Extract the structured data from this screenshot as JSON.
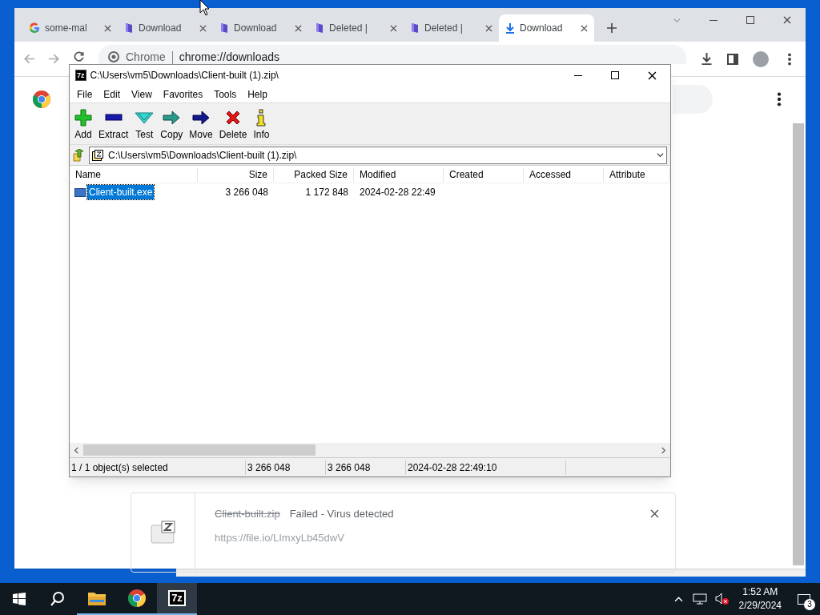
{
  "browser": {
    "tabs": [
      {
        "label": "some-mal",
        "kind": "google",
        "selected": false
      },
      {
        "label": "Download",
        "kind": "doc",
        "selected": false
      },
      {
        "label": "Download",
        "kind": "doc",
        "selected": false
      },
      {
        "label": "Deleted |",
        "kind": "doc",
        "selected": false
      },
      {
        "label": "Deleted |",
        "kind": "doc",
        "selected": false
      },
      {
        "label": "Download",
        "kind": "download",
        "selected": true
      }
    ],
    "address": {
      "site": "Chrome",
      "url": "chrome://downloads"
    },
    "download_card": {
      "file": "Client-built.zip",
      "status": "Failed - Virus detected",
      "url": "https://file.io/LImxyLb45dwV"
    }
  },
  "archiver": {
    "icon_label": "7z",
    "title": "C:\\Users\\vm5\\Downloads\\Client-built (1).zip\\",
    "menu": [
      "File",
      "Edit",
      "View",
      "Favorites",
      "Tools",
      "Help"
    ],
    "toolbar": [
      {
        "kind": "add",
        "label": "Add"
      },
      {
        "kind": "extract",
        "label": "Extract"
      },
      {
        "kind": "test",
        "label": "Test"
      },
      {
        "kind": "copy",
        "label": "Copy"
      },
      {
        "kind": "move",
        "label": "Move"
      },
      {
        "kind": "delete",
        "label": "Delete"
      },
      {
        "kind": "info",
        "label": "Info"
      }
    ],
    "path": "C:\\Users\\vm5\\Downloads\\Client-built (1).zip\\",
    "columns": [
      "Name",
      "Size",
      "Packed Size",
      "Modified",
      "Created",
      "Accessed",
      "Attribute"
    ],
    "rows": [
      {
        "name": "Client-built.exe",
        "size": "3 266 048",
        "packed": "1 172 848",
        "modified": "2024-02-28 22:49",
        "selected": true
      }
    ],
    "status_bar": [
      "1 / 1 object(s) selected",
      "3 266 048",
      "3 266 048",
      "2024-02-28 22:49:10"
    ]
  },
  "taskbar": {
    "time": "1:52 AM",
    "date": "2/29/2024",
    "notifications": "3",
    "apps": [
      {
        "kind": "explorer",
        "active": false
      },
      {
        "kind": "chrome",
        "active": false
      },
      {
        "kind": "sevenzip",
        "label": "7z",
        "active": true
      }
    ]
  }
}
